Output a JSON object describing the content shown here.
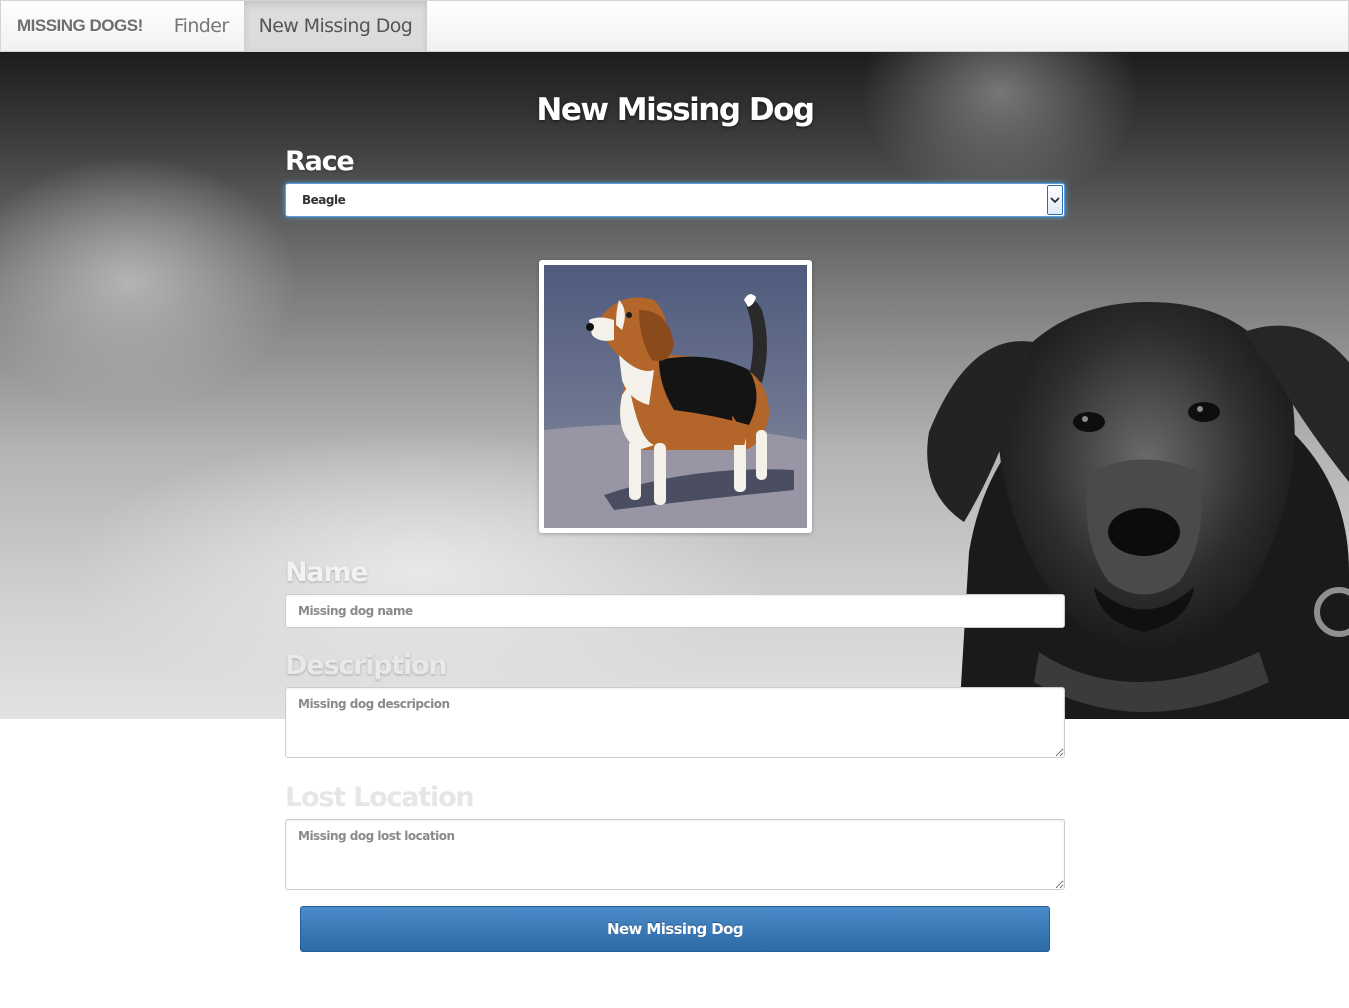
{
  "navbar": {
    "brand": "MISSING DOGS!",
    "items": [
      {
        "label": "Finder",
        "active": false
      },
      {
        "label": "New Missing Dog",
        "active": true
      }
    ]
  },
  "form": {
    "title": "New Missing Dog",
    "race": {
      "label": "Race",
      "selected": "Beagle"
    },
    "photo": {
      "subject": "beagle"
    },
    "name": {
      "label": "Name",
      "value": "",
      "placeholder": "Missing dog name"
    },
    "description": {
      "label": "Description",
      "value": "",
      "placeholder": "Missing dog descripcion"
    },
    "lost_location": {
      "label": "Lost Location",
      "value": "",
      "placeholder": "Missing dog lost location"
    },
    "submit_label": "New Missing Dog"
  },
  "colors": {
    "primary_button": "#2d6aa5",
    "focus_ring": "#52a8ec",
    "navbar_bg": "#f5f5f5"
  }
}
